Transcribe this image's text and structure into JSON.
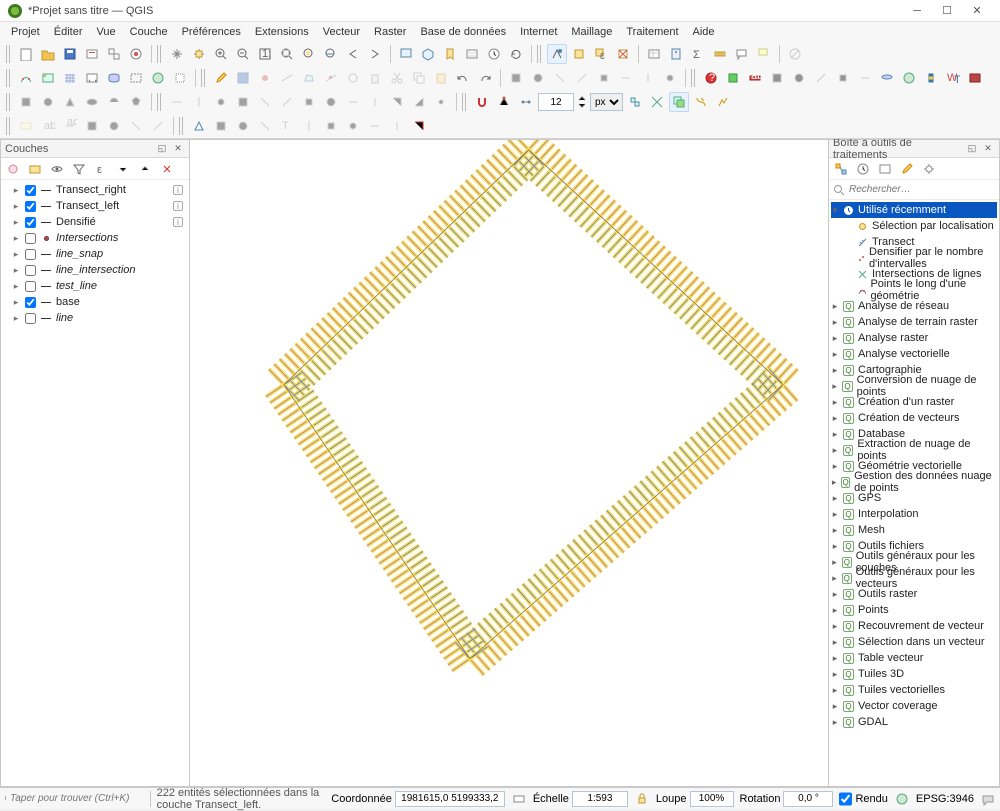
{
  "window": {
    "title": "*Projet sans titre — QGIS"
  },
  "menu": [
    "Projet",
    "Éditer",
    "Vue",
    "Couche",
    "Préférences",
    "Extensions",
    "Vecteur",
    "Raster",
    "Base de données",
    "Internet",
    "Maillage",
    "Traitement",
    "Aide"
  ],
  "toolbar": {
    "snap_value": "12",
    "snap_unit": "px"
  },
  "layers_panel": {
    "title": "Couches",
    "items": [
      {
        "checked": true,
        "sym": "line",
        "label": "Transect_right",
        "info": true
      },
      {
        "checked": true,
        "sym": "line",
        "label": "Transect_left",
        "info": true
      },
      {
        "checked": true,
        "sym": "line",
        "label": "Densifié",
        "info": true
      },
      {
        "checked": false,
        "sym": "pt",
        "label": "Intersections",
        "italic": true
      },
      {
        "checked": false,
        "sym": "line",
        "label": "line_snap",
        "italic": true
      },
      {
        "checked": false,
        "sym": "line",
        "label": "line_intersection",
        "italic": true
      },
      {
        "checked": false,
        "sym": "line",
        "label": "test_line",
        "italic": true
      },
      {
        "checked": true,
        "sym": "line",
        "label": "base"
      },
      {
        "checked": false,
        "sym": "line",
        "label": "line",
        "italic": true
      }
    ]
  },
  "processing_panel": {
    "title": "Boîte à outils de traitements",
    "search_placeholder": "Rechercher…",
    "recent_title": "Utilisé récemment",
    "recent": [
      "Sélection par localisation",
      "Transect",
      "Densifier par le nombre d'intervalles",
      "Intersections de lignes",
      "Points le long d'une géométrie"
    ],
    "categories": [
      "Analyse de réseau",
      "Analyse de terrain raster",
      "Analyse raster",
      "Analyse vectorielle",
      "Cartographie",
      "Conversion de nuage de points",
      "Création d'un raster",
      "Création de vecteurs",
      "Database",
      "Extraction de nuage de points",
      "Géométrie vectorielle",
      "Gestion des données nuage de points",
      "GPS",
      "Interpolation",
      "Mesh",
      "Outils fichiers",
      "Outils généraux pour les couches",
      "Outils généraux pour les vecteurs",
      "Outils raster",
      "Points",
      "Recouvrement de vecteur",
      "Sélection dans un vecteur",
      "Table vecteur",
      "Tuiles 3D",
      "Tuiles vectorielles",
      "Vector coverage",
      "GDAL"
    ]
  },
  "status": {
    "find_placeholder": "Taper pour trouver (Ctrl+K)",
    "selection_msg": "222 entités sélectionnées dans la couche Transect_left.",
    "coord_label": "Coordonnée",
    "coord_value": "1981615,0 5199333,2",
    "scale_label": "Échelle",
    "scale_value": "1:593",
    "loupe_label": "Loupe",
    "loupe_value": "100%",
    "rotation_label": "Rotation",
    "rotation_value": "0,0 °",
    "render_label": "Rendu",
    "crs_value": "EPSG:3946"
  }
}
